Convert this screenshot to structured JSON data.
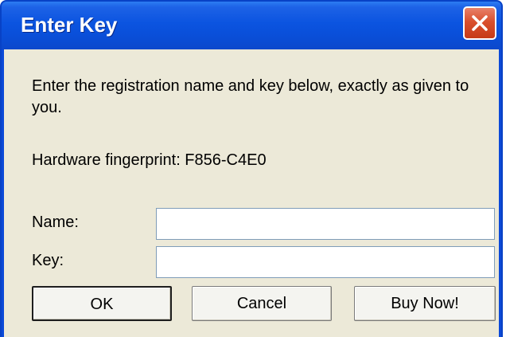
{
  "window": {
    "title": "Enter Key"
  },
  "dialog": {
    "instructions": "Enter the registration name and key below, exactly as given to you.",
    "fingerprint_text": "Hardware fingerprint: F856-C4E0"
  },
  "form": {
    "name_label": "Name:",
    "name_value": "",
    "key_label": "Key:",
    "key_value": ""
  },
  "buttons": {
    "ok_label": "OK",
    "cancel_label": "Cancel",
    "buy_label": "Buy Now!"
  },
  "icons": {
    "close": "close-icon"
  },
  "colors": {
    "titlebar": "#0b54e0",
    "client": "#ece9d8",
    "close_button": "#d9502e"
  }
}
